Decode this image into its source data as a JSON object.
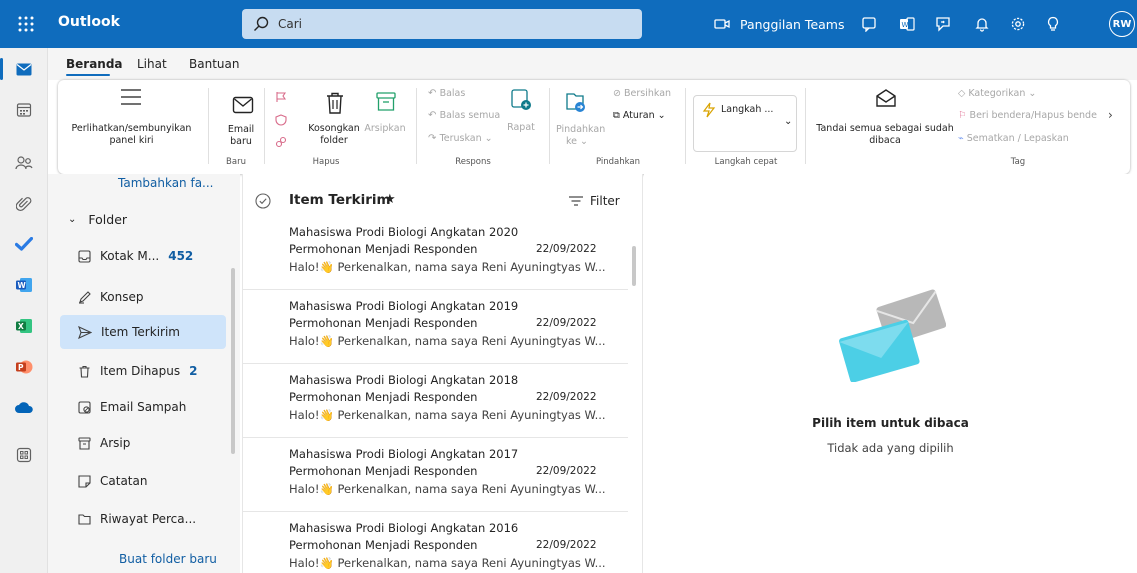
{
  "app_title": "Outlook",
  "search": {
    "placeholder": "Cari"
  },
  "topbar": {
    "teams_label": "Panggilan Teams",
    "avatar_initials": "RW"
  },
  "tabs": [
    "Beranda",
    "Lihat",
    "Bantuan"
  ],
  "ribbon": {
    "toggle_pane": "Perlihatkan/sembunyikan panel kiri",
    "new_email": "Email baru",
    "empty_folder": "Kosongkan folder",
    "archive": "Arsipkan",
    "reply": "Balas",
    "reply_all": "Balas semua",
    "forward": "Teruskan",
    "meeting": "Rapat",
    "move": "Pindahkan ke",
    "sweep": "Bersihkan",
    "rules": "Aturan",
    "quick_steps": "Langkah ...",
    "mark_all_read": "Tandai semua sebagai sudah dibaca",
    "categorize": "Kategorikan",
    "flag": "Beri bendera/Hapus bende",
    "pin": "Sematkan / Lepaskan",
    "groups": {
      "new": "Baru",
      "delete": "Hapus",
      "respond": "Respons",
      "move": "Pindahkan",
      "quick_steps": "Langkah cepat",
      "tags": "Tag"
    }
  },
  "folders": {
    "add_favorite": "Tambahkan fa...",
    "section": "Folder",
    "items": [
      {
        "label": "Kotak M...",
        "count": "452",
        "icon": "inbox-icon"
      },
      {
        "label": "Konsep",
        "count": "",
        "icon": "draft-icon"
      },
      {
        "label": "Item Terkirim",
        "count": "",
        "icon": "sent-icon",
        "selected": true
      },
      {
        "label": "Item Dihapus",
        "count": "2",
        "icon": "trash-icon"
      },
      {
        "label": "Email Sampah",
        "count": "",
        "icon": "junk-icon"
      },
      {
        "label": "Arsip",
        "count": "",
        "icon": "archive-icon"
      },
      {
        "label": "Catatan",
        "count": "",
        "icon": "notes-icon"
      },
      {
        "label": "Riwayat Perca...",
        "count": "",
        "icon": "chat-history-icon"
      }
    ],
    "new_folder": "Buat folder baru"
  },
  "list": {
    "title": "Item Terkirim",
    "filter_label": "Filter",
    "messages": [
      {
        "from": "Mahasiswa Prodi Biologi Angkatan 2020",
        "subject": "Permohonan Menjadi Responden",
        "date": "22/09/2022",
        "preview": "Halo!👋 Perkenalkan, nama saya Reni Ayuningtyas W..."
      },
      {
        "from": "Mahasiswa Prodi Biologi Angkatan 2019",
        "subject": "Permohonan Menjadi Responden",
        "date": "22/09/2022",
        "preview": "Halo!👋 Perkenalkan, nama saya Reni Ayuningtyas W..."
      },
      {
        "from": "Mahasiswa Prodi Biologi Angkatan 2018",
        "subject": "Permohonan Menjadi Responden",
        "date": "22/09/2022",
        "preview": "Halo!👋 Perkenalkan, nama saya Reni Ayuningtyas W..."
      },
      {
        "from": "Mahasiswa Prodi Biologi Angkatan 2017",
        "subject": "Permohonan Menjadi Responden",
        "date": "22/09/2022",
        "preview": "Halo!👋 Perkenalkan, nama saya Reni Ayuningtyas W..."
      },
      {
        "from": "Mahasiswa Prodi Biologi Angkatan 2016",
        "subject": "Permohonan Menjadi Responden",
        "date": "22/09/2022",
        "preview": "Halo!👋 Perkenalkan, nama saya Reni Ayuningtyas W..."
      }
    ]
  },
  "reading": {
    "title": "Pilih item untuk dibaca",
    "subtitle": "Tidak ada yang dipilih"
  },
  "colors": {
    "brand": "#0f6cbd",
    "selected": "#cfe4fa",
    "envelope_front": "#4ccfe6",
    "envelope_back": "#b8b8b8"
  }
}
